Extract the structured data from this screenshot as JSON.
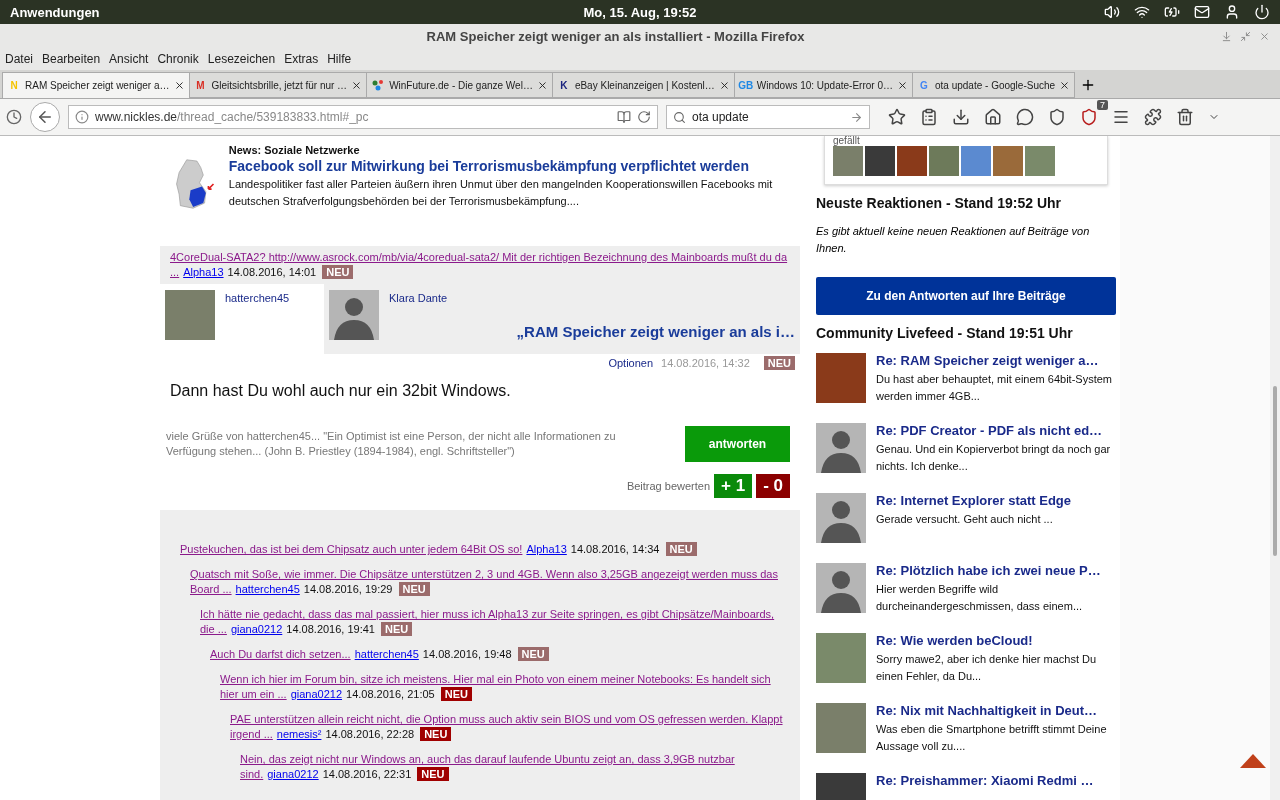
{
  "panel": {
    "apps": "Anwendungen",
    "clock": "Mo, 15. Aug, 19:52"
  },
  "window": {
    "title": "RAM Speicher zeigt weniger an als installiert - Mozilla Firefox"
  },
  "menu": [
    "Datei",
    "Bearbeiten",
    "Ansicht",
    "Chronik",
    "Lesezeichen",
    "Extras",
    "Hilfe"
  ],
  "tabs": [
    {
      "label": "RAM Speicher zeigt weniger a…",
      "selected": true,
      "icon": {
        "kind": "letter",
        "glyph": "N",
        "color": "#f5c400"
      }
    },
    {
      "label": "Gleitsichtsbrille, jetzt für nur …",
      "selected": false,
      "icon": {
        "kind": "letter",
        "glyph": "M",
        "color": "#d93025"
      }
    },
    {
      "label": "WinFuture.de - Die ganze Wel…",
      "selected": false,
      "icon": {
        "kind": "dots",
        "color": "#2e7d32"
      }
    },
    {
      "label": "eBay Kleinanzeigen | Kostenl…",
      "selected": false,
      "icon": {
        "kind": "letter",
        "glyph": "K",
        "color": "#1a237e"
      }
    },
    {
      "label": "Windows 10: Update-Error 0…",
      "selected": false,
      "icon": {
        "kind": "letter",
        "glyph": "GB",
        "color": "#1e88e5"
      }
    },
    {
      "label": "ota update - Google-Suche",
      "selected": false,
      "icon": {
        "kind": "letter",
        "glyph": "G",
        "color": "#4285f4"
      }
    }
  ],
  "nav": {
    "domain": "www.nickles.de",
    "path": "/thread_cache/539183833.html#_pc",
    "search": "ota update",
    "addon_badge": "7"
  },
  "news": {
    "category": "News: Soziale Netzwerke",
    "headline": "Facebook soll zur Mitwirkung bei Terrorismusbekämpfung verpflichtet werden",
    "teaser": "Landespolitiker fast aller Parteien äußern ihren Unmut über den mangelnden Kooperationswillen Facebooks mit deutschen Strafverfolgungsbehörden bei der Terrorismusbekämpfung...."
  },
  "parent_post": {
    "text": "4CoreDual-SATA2? http://www.asrock.com/mb/via/4coredual-sata2/ Mit der richtigen Bezeichnung des Mainboards mußt du da ...",
    "author": "Alpha13",
    "date": "14.08.2016, 14:01",
    "badge": "NEU",
    "color": "#9b6b6b"
  },
  "post": {
    "author": {
      "name": "hatterchen45",
      "avatar": {
        "kind": "photo"
      }
    },
    "recipient": {
      "name": "Klara Dante",
      "avatar": {
        "kind": "silhouette"
      }
    },
    "title": "„RAM Speicher zeigt weniger an als i…",
    "options": "Optionen",
    "date": "14.08.2016, 14:32",
    "badge": "NEU",
    "color": "#9b6b6b",
    "body": "Dann hast Du wohl auch nur ein 32bit Windows.",
    "signature": "viele Grüße von hatterchen45... \"Ein Optimist ist eine Person, der nicht alle Informationen zu Verfügung stehen... (John B. Priestley (1894-1984), engl. Schriftsteller\")",
    "reply_button": "antworten",
    "rate_label": "Beitrag bewerten",
    "plus": "+ 1",
    "minus": "- 0"
  },
  "thread": [
    {
      "text": "Pustekuchen, das ist bei dem Chipsatz auch unter jedem 64Bit OS so!",
      "author": "Alpha13",
      "date": "14.08.2016, 14:34",
      "badge": "NEU",
      "color": "#9b6b6b",
      "children": [
        {
          "text": "Quatsch mit Soße, wie immer. Die Chipsätze unterstützen 2, 3 und 4GB. Wenn also 3,25GB angezeigt werden muss das Board ...",
          "author": "hatterchen45",
          "date": "14.08.2016, 19:29",
          "badge": "NEU",
          "color": "#9b6b6b",
          "children": [
            {
              "text": "Ich hätte nie gedacht, dass das mal passiert, hier muss ich Alpha13 zur Seite springen, es gibt Chipsätze/Mainboards, die ...",
              "author": "giana0212",
              "date": "14.08.2016, 19:41",
              "badge": "NEU",
              "color": "#9b6b6b",
              "children": [
                {
                  "text": "Auch Du darfst dich setzen...",
                  "author": "hatterchen45",
                  "date": "14.08.2016, 19:48",
                  "badge": "NEU",
                  "color": "#9b6b6b",
                  "children": [
                    {
                      "text": "Wenn ich hier im Forum bin, sitze ich meistens. Hier mal ein Photo von einem meiner Notebooks: Es handelt sich hier um ein ...",
                      "author": "giana0212",
                      "date": "14.08.2016, 21:05",
                      "badge": "NEU",
                      "color": "#a00000",
                      "children": [
                        {
                          "text": "PAE unterstützen allein reicht nicht, die Option muss auch aktiv sein BIOS und vom OS gefressen werden. Klappt irgend ...",
                          "author": "nemesis²",
                          "date": "14.08.2016, 22:28",
                          "badge": "NEU",
                          "color": "#a00000",
                          "children": [
                            {
                              "text": "Nein, das zeigt nicht nur Windows an, auch das darauf laufende Ubuntu zeigt an, dass 3,9GB nutzbar sind.",
                              "author": "giana0212",
                              "date": "14.08.2016, 22:31",
                              "badge": "NEU",
                              "color": "#a00000"
                            }
                          ]
                        }
                      ]
                    }
                  ]
                }
              ]
            }
          ]
        }
      ]
    }
  ],
  "sidebar": {
    "liked_label": "gefällt",
    "reactions_heading": "Neuste Reaktionen - Stand 19:52 Uhr",
    "reactions_empty": "Es gibt aktuell keine neuen Reaktionen auf Beiträge von Ihnen.",
    "reactions_button": "Zu den Antworten auf Ihre Beiträge",
    "livefeed_heading": "Community Livefeed - Stand 19:51 Uhr",
    "livefeed": [
      {
        "avatar": {
          "kind": "photo"
        },
        "title": "Re: RAM Speicher zeigt weniger a…",
        "snippet": "Du hast aber behauptet, mit einem 64bit-System werden immer 4GB..."
      },
      {
        "avatar": {
          "kind": "silhouette"
        },
        "title": "Re: PDF Creator - PDF als nicht ed…",
        "snippet": "Genau. Und ein Kopierverbot bringt da noch gar nichts. Ich denke..."
      },
      {
        "avatar": {
          "kind": "silhouette"
        },
        "title": "Re: Internet Explorer statt Edge",
        "snippet": "Gerade versucht. Geht auch nicht ..."
      },
      {
        "avatar": {
          "kind": "silhouette"
        },
        "title": "Re: Plötzlich habe ich zwei neue P…",
        "snippet": "Hier werden Begriffe wild durcheinandergeschmissen, dass einem..."
      },
      {
        "avatar": {
          "kind": "photo"
        },
        "title": "Re: Wie werden beCloud!",
        "snippet": "Sorry mawe2, aber ich denke hier machst Du einen Fehler, da Du..."
      },
      {
        "avatar": {
          "kind": "photo"
        },
        "title": "Re: Nix mit Nachhaltigkeit in Deut…",
        "snippet": "Was eben die Smartphone betrifft stimmt Deine Aussage voll zu...."
      },
      {
        "avatar": {
          "kind": "photo"
        },
        "title": "Re: Preishammer: Xiaomi Redmi …"
      }
    ]
  }
}
